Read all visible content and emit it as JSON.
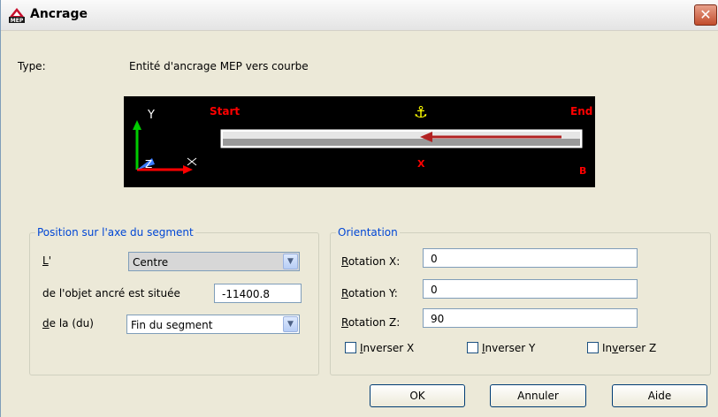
{
  "window": {
    "title": "Ancrage",
    "close_glyph": "✕",
    "app_icon": "mep-app-icon"
  },
  "type_row": {
    "label": "Type:",
    "value": "Entité d'ancrage MEP vers courbe"
  },
  "preview": {
    "axis_y_label": "Y",
    "axis_z_label": "Z",
    "start_label": "Start",
    "end_label": "End",
    "x_label": "X",
    "b_label": "B",
    "anchor_glyph": "⚓",
    "colors": {
      "background": "#000000",
      "start_end": "#ff0000",
      "anchor": "#ffff00",
      "arrow": "#b22222",
      "axis_y": "#00cc00",
      "axis_x": "#ff0000",
      "axis_z": "#3a7bff"
    }
  },
  "position_group": {
    "legend": "Position sur l'axe du segment",
    "l_label_prefix": "L",
    "l_label_suffix": "'",
    "l_combo_value": "Centre",
    "anchored_label": "de l'objet ancré est située",
    "anchored_value": "-11400.8",
    "from_label_prefix": "d",
    "from_label_suffix": "e la (du)",
    "from_combo_value": "Fin du segment"
  },
  "orientation_group": {
    "legend": "Orientation",
    "rotation_x": {
      "label_prefix": "R",
      "label_suffix": "otation X:",
      "value": "0"
    },
    "rotation_y": {
      "label_prefix": "R",
      "label_suffix": "otation Y:",
      "value": "0"
    },
    "rotation_z": {
      "label_prefix": "R",
      "label_suffix": "otation Z:",
      "value": "90"
    },
    "invert_x": {
      "prefix": "I",
      "suffix": "nverser X",
      "checked": false
    },
    "invert_y": {
      "prefix": "I",
      "suffix": "nverser Y",
      "checked": false
    },
    "invert_z": {
      "prefix": "In",
      "u": "v",
      "suffix": "erser Z",
      "checked": false
    }
  },
  "buttons": {
    "ok": "OK",
    "cancel": "Annuler",
    "help": "Aide"
  }
}
